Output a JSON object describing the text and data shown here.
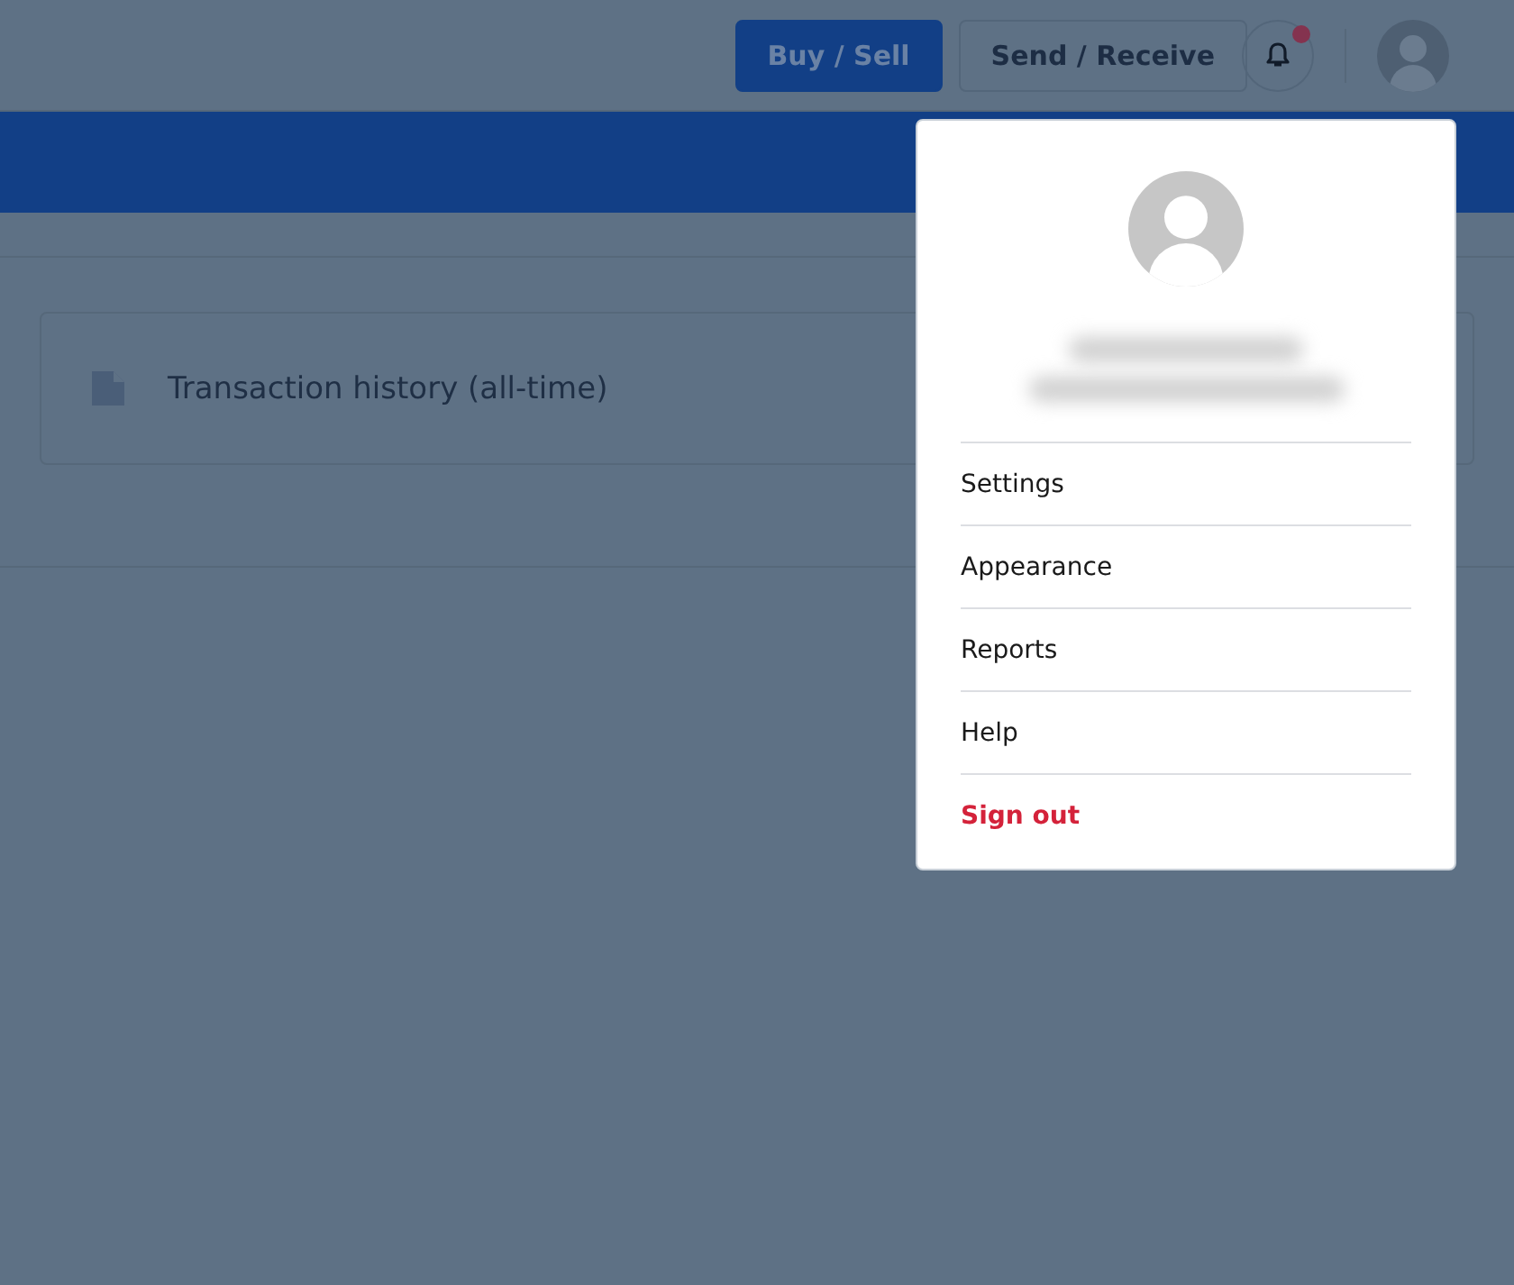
{
  "header": {
    "buttons": [
      {
        "label": "Buy / Sell",
        "kind": "primary"
      },
      {
        "label": "Send / Receive",
        "kind": "secondary"
      }
    ],
    "notifications_unread": true
  },
  "reports": [
    {
      "label": "Transaction history (all-time)"
    }
  ],
  "account_menu": {
    "open": true,
    "items": [
      {
        "label": "Settings",
        "kind": "normal"
      },
      {
        "label": "Appearance",
        "kind": "normal"
      },
      {
        "label": "Reports",
        "kind": "normal"
      },
      {
        "label": "Help",
        "kind": "normal"
      },
      {
        "label": "Sign out",
        "kind": "danger"
      }
    ]
  }
}
